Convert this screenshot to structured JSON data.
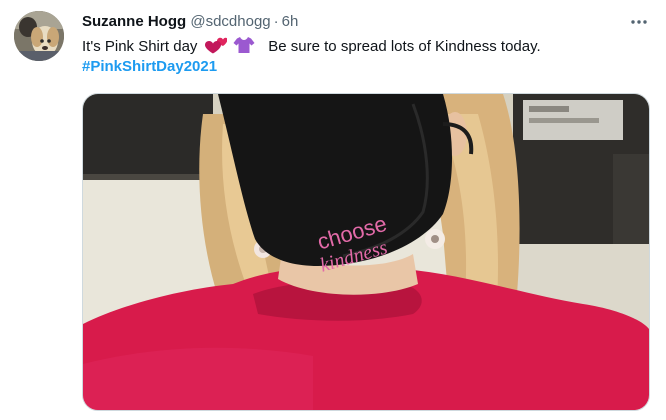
{
  "tweet": {
    "author": {
      "display_name": "Suzanne Hogg",
      "handle": "@sdcdhogg",
      "separator": "·",
      "timestamp": "6h"
    },
    "text": {
      "part1": "It's Pink Shirt day",
      "part2": "Be sure to spread lots of Kindness today.",
      "hashtag": "#PinkShirtDay2021"
    },
    "emojis": [
      "two-hearts-emoji",
      "shirt-emoji"
    ],
    "more_icon": "more-horizontal-icon",
    "media": {
      "mask_text_line1": "choose",
      "mask_text_line2": "kindness"
    }
  },
  "colors": {
    "hashtag": "#1d9bf0",
    "secondary_text": "#536471",
    "sweater": "#d81b4b",
    "mask": "#151515",
    "mask_print": "#e26aa8"
  }
}
